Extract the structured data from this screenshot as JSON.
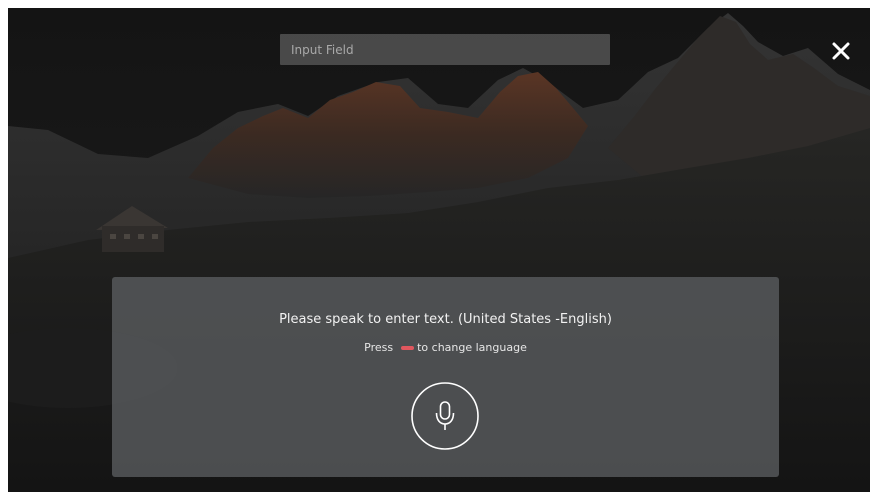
{
  "input": {
    "placeholder": "Input Field"
  },
  "close": {
    "icon": "close-icon"
  },
  "voice_panel": {
    "prompt": "Please speak to enter text. (United States -English)",
    "hint_prefix": "Press",
    "hint_suffix": "to change language",
    "key_icon": "red-key-icon",
    "mic_icon": "microphone-icon"
  },
  "colors": {
    "panel": "#585a5d",
    "red_key": "#e0575e",
    "text": "#ffffff"
  }
}
